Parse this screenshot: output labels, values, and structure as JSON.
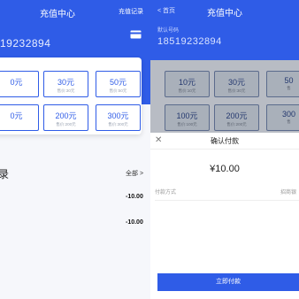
{
  "left": {
    "title": "充值中心",
    "record_link": "充值记录",
    "phone": "19232894",
    "options": [
      {
        "amount": "0元",
        "sub": ""
      },
      {
        "amount": "30元",
        "sub": "售价:30元"
      },
      {
        "amount": "50元",
        "sub": "售价:50元"
      },
      {
        "amount": "0元",
        "sub": ""
      },
      {
        "amount": "200元",
        "sub": "售价:200元"
      },
      {
        "amount": "300元",
        "sub": "售价:300元"
      }
    ],
    "history_title": "录",
    "all_link": "全部 >",
    "records": [
      "-10.00",
      "-10.00"
    ]
  },
  "right": {
    "back": "< 首页",
    "title": "充值中心",
    "phone_label": "默认号码",
    "phone": "18519232894",
    "options": [
      {
        "amount": "10元",
        "sub": "售价:10元"
      },
      {
        "amount": "30元",
        "sub": "售价:30元"
      },
      {
        "amount": "50",
        "sub": "售"
      },
      {
        "amount": "100元",
        "sub": "售价:100元"
      },
      {
        "amount": "200元",
        "sub": "售价:200元"
      },
      {
        "amount": "300",
        "sub": "售"
      }
    ],
    "sheet": {
      "close": "✕",
      "title": "确认付款",
      "price": "¥10.00",
      "method_label": "付款方式",
      "method_value": "招商银",
      "pay_button": "立即付款"
    }
  },
  "colors": {
    "accent": "#2f5ce7",
    "overlay_gray": "#b8bcc4"
  },
  "icons": {
    "card": "bank-card-icon"
  }
}
